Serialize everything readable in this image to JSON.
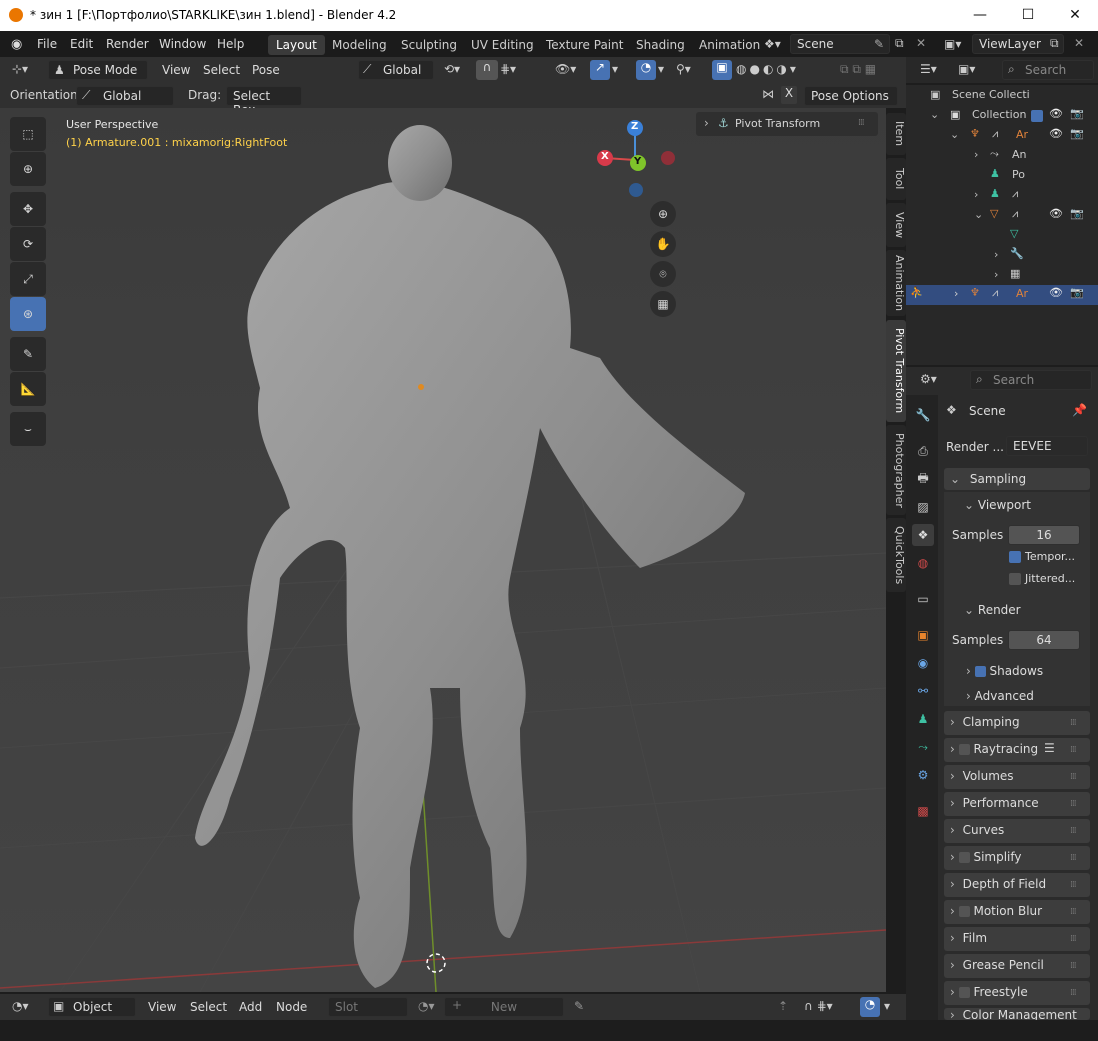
{
  "window": {
    "title": "* зин 1 [F:\\Портфолио\\STARKLIKE\\зин 1.blend] - Blender 4.2",
    "min": "—",
    "max": "☐",
    "close": "✕"
  },
  "menu": [
    "File",
    "Edit",
    "Render",
    "Window",
    "Help"
  ],
  "workspaces": [
    "Layout",
    "Modeling",
    "Sculpting",
    "UV Editing",
    "Texture Paint",
    "Shading",
    "Animation"
  ],
  "scene": {
    "label": "Scene",
    "view_layer": "ViewLayer"
  },
  "header": {
    "mode": "Pose Mode",
    "view": "View",
    "select": "Select",
    "pose": "Pose",
    "transform": "Global"
  },
  "header2": {
    "orientation_label": "Orientation:",
    "orientation": "Global",
    "drag_label": "Drag:",
    "drag": "Select Box",
    "pose_options": "Pose Options"
  },
  "viewport": {
    "perspective": "User Perspective",
    "active": "(1) Armature.001 : mixamorig:RightFoot",
    "pivot_panel": "Pivot Transform",
    "gizmo": {
      "x": "X",
      "y": "Y",
      "z": "Z"
    }
  },
  "side_tabs": [
    "Item",
    "Tool",
    "View",
    "Animation",
    "Pivot Transform",
    "Photographer",
    "QuickTools"
  ],
  "bottom": {
    "editor": "Object",
    "view": "View",
    "select": "Select",
    "add": "Add",
    "node": "Node",
    "slot": "Slot",
    "new": "New"
  },
  "outliner": {
    "search": "Search",
    "rows": [
      "Scene Collecti",
      "Collection",
      "Ar",
      "An",
      "Po",
      "",
      "",
      "",
      "",
      ""
    ]
  },
  "properties": {
    "search": "Search",
    "scene": "Scene",
    "render_label": "Render ...",
    "engine": "EEVEE",
    "sampling": "Sampling",
    "viewport": "Viewport",
    "samples_label": "Samples",
    "viewport_samples": "16",
    "temporal": "Tempor...",
    "jittered": "Jittered...",
    "render": "Render",
    "render_samples": "64",
    "shadows": "Shadows",
    "advanced": "Advanced",
    "panels": [
      "Clamping",
      "Raytracing",
      "Volumes",
      "Performance",
      "Curves",
      "Simplify",
      "Depth of Field",
      "Motion Blur",
      "Film",
      "Grease Pencil",
      "Freestyle",
      "Color Management"
    ]
  }
}
